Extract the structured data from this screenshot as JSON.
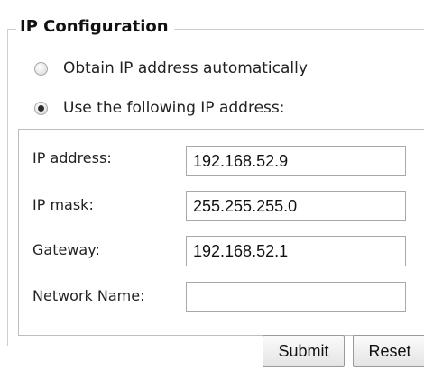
{
  "group": {
    "legend": "IP Configuration"
  },
  "options": {
    "auto": {
      "label": "Obtain IP address automatically",
      "selected": false
    },
    "manual": {
      "label": "Use the following IP address:",
      "selected": true
    }
  },
  "fields": {
    "ip_address": {
      "label": "IP address:",
      "value": "192.168.52.9"
    },
    "ip_mask": {
      "label": "IP mask:",
      "value": "255.255.255.0"
    },
    "gateway": {
      "label": "Gateway:",
      "value": "192.168.52.1"
    },
    "network_name": {
      "label": "Network Name:",
      "value": ""
    }
  },
  "buttons": {
    "submit": "Submit",
    "reset": "Reset"
  }
}
